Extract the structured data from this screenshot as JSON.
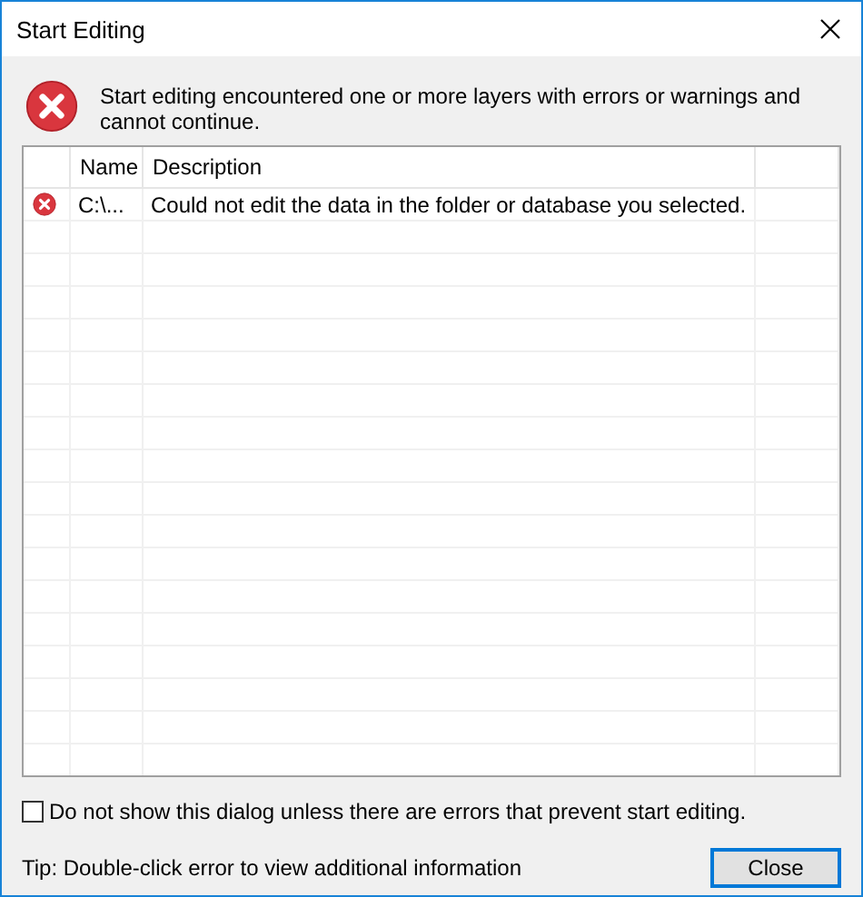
{
  "window": {
    "title": "Start Editing"
  },
  "message": "Start editing encountered one or more layers with errors or warnings and cannot continue.",
  "table": {
    "columns": [
      "Name",
      "Description"
    ],
    "rows": [
      {
        "kind": "error",
        "name": "C:\\...",
        "description": "Could not edit the data in the folder or database you selected."
      }
    ]
  },
  "option": {
    "label": "Do not show this dialog unless there are errors that prevent start editing.",
    "checked": false
  },
  "tip": "Tip: Double-click error to view additional information",
  "buttons": [
    "Close"
  ]
}
